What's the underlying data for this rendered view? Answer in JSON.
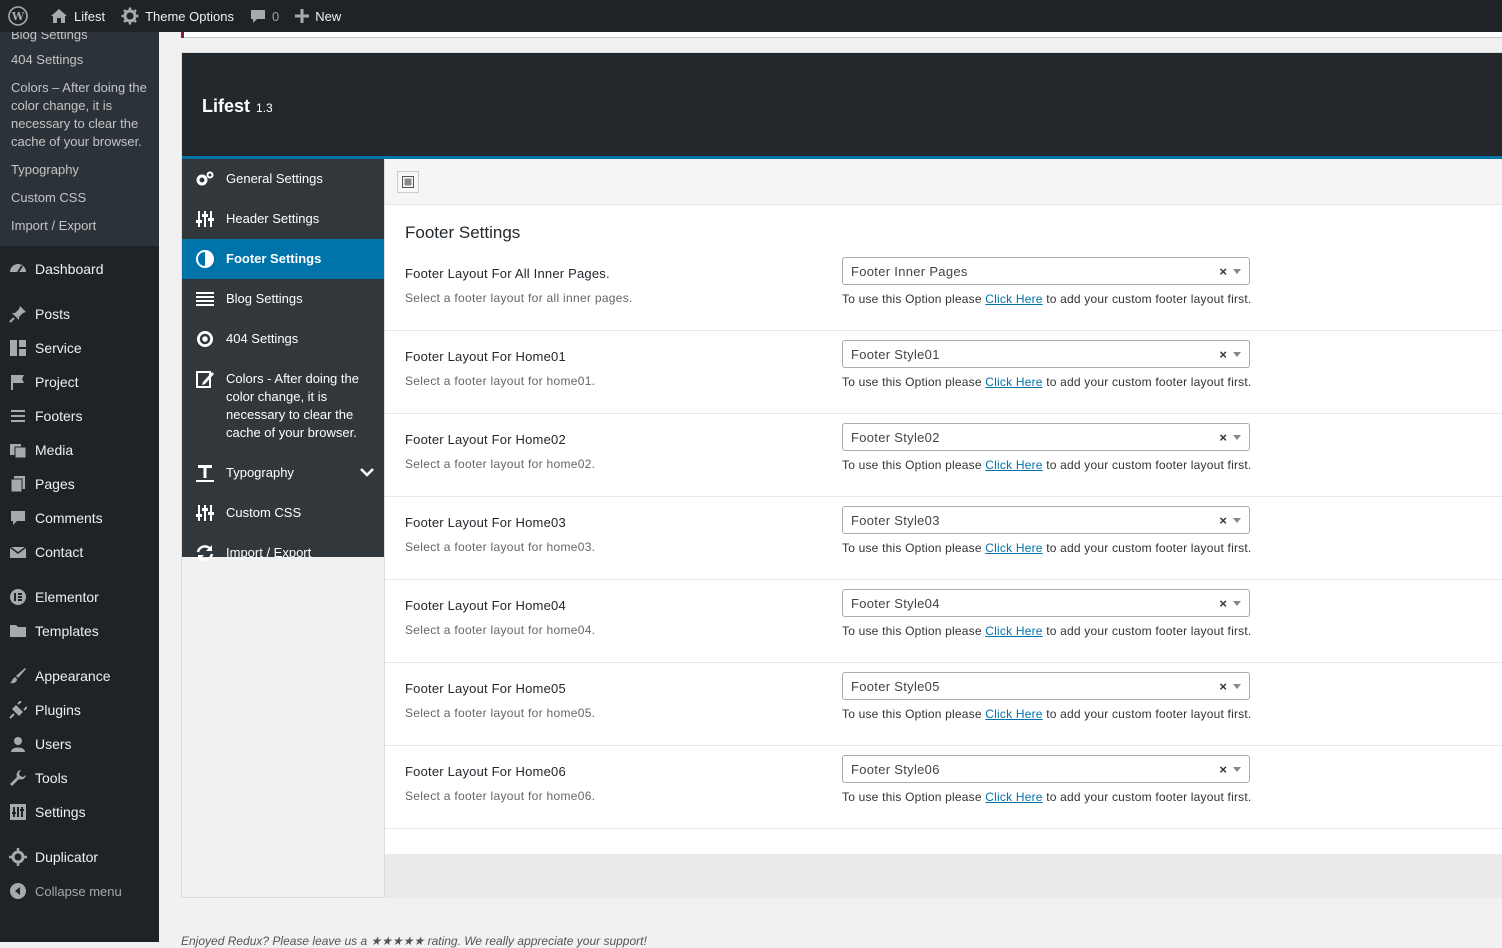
{
  "adminbar": {
    "site_name": "Lifest",
    "theme_options": "Theme Options",
    "comments_count": "0",
    "new_label": "New"
  },
  "submenu": {
    "cut_item": "Blog Settings",
    "items": [
      "404 Settings",
      "Colors – After doing the color change, it is necessary to clear the cache of your browser.",
      "Typography",
      "Custom CSS",
      "Import / Export"
    ]
  },
  "menu": {
    "dashboard": "Dashboard",
    "posts": "Posts",
    "service": "Service",
    "project": "Project",
    "footers": "Footers",
    "media": "Media",
    "pages": "Pages",
    "comments": "Comments",
    "contact": "Contact",
    "elementor": "Elementor",
    "templates": "Templates",
    "appearance": "Appearance",
    "plugins": "Plugins",
    "users": "Users",
    "tools": "Tools",
    "settings": "Settings",
    "duplicator": "Duplicator",
    "collapse": "Collapse menu"
  },
  "redux": {
    "title": "Lifest",
    "version": "1.3",
    "sidebar": {
      "general": "General Settings",
      "header": "Header Settings",
      "footer": "Footer Settings",
      "blog": "Blog Settings",
      "s404": "404 Settings",
      "colors": "Colors - After doing the color change, it is necessary to clear the cache of your browser.",
      "typography": "Typography",
      "custom_css": "Custom CSS",
      "import_export": "Import / Export"
    },
    "section_title": "Footer Settings",
    "note_prefix": "To use this Option please",
    "note_link": "Click Here",
    "note_suffix": "to add your custom footer layout first.",
    "clear_symbol": "×",
    "fields": [
      {
        "title": "Footer Layout For All Inner Pages.",
        "desc": "Select a footer layout for all inner pages.",
        "value": "Footer Inner Pages"
      },
      {
        "title": "Footer Layout For Home01",
        "desc": "Select a footer layout for home01.",
        "value": "Footer Style01"
      },
      {
        "title": "Footer Layout For Home02",
        "desc": "Select a footer layout for home02.",
        "value": "Footer Style02"
      },
      {
        "title": "Footer Layout For Home03",
        "desc": "Select a footer layout for home03.",
        "value": "Footer Style03"
      },
      {
        "title": "Footer Layout For Home04",
        "desc": "Select a footer layout for home04.",
        "value": "Footer Style04"
      },
      {
        "title": "Footer Layout For Home05",
        "desc": "Select a footer layout for home05.",
        "value": "Footer Style05"
      },
      {
        "title": "Footer Layout For Home06",
        "desc": "Select a footer layout for home06.",
        "value": "Footer Style06"
      }
    ]
  },
  "below_text": "Enjoyed Redux? Please leave us a ★★★★★ rating. We really appreciate your support!"
}
